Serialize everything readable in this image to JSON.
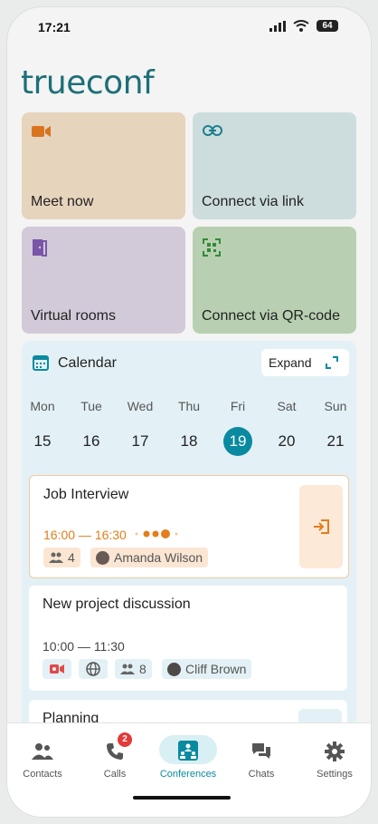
{
  "status_bar": {
    "time": "17:21",
    "battery": "64"
  },
  "app": {
    "logo": "trueconf"
  },
  "tiles": [
    {
      "label": "Meet now",
      "icon": "video-camera-icon",
      "color": "#e7d4bd"
    },
    {
      "label": "Connect via link",
      "icon": "link-icon",
      "color": "#cdddde"
    },
    {
      "label": "Virtual rooms",
      "icon": "door-icon",
      "color": "#d2cad8"
    },
    {
      "label": "Connect via QR-code",
      "icon": "qr-code-icon",
      "color": "#b8d0b1"
    }
  ],
  "calendar": {
    "title": "Calendar",
    "expand_label": "Expand",
    "days": [
      {
        "name": "Mon",
        "num": "15"
      },
      {
        "name": "Tue",
        "num": "16"
      },
      {
        "name": "Wed",
        "num": "17"
      },
      {
        "name": "Thu",
        "num": "18"
      },
      {
        "name": "Fri",
        "num": "19"
      },
      {
        "name": "Sat",
        "num": "20"
      },
      {
        "name": "Sun",
        "num": "21"
      }
    ],
    "events": [
      {
        "title": "Job Interview",
        "time": "16:00 — 16:30",
        "participants": "4",
        "person": "Amanda Wilson"
      },
      {
        "title": "New project discussion",
        "time": "10:00 — 11:30",
        "participants": "8",
        "person": "Cliff Brown"
      },
      {
        "title": "Planning"
      }
    ]
  },
  "tabs": [
    {
      "label": "Contacts",
      "icon": "contacts-icon"
    },
    {
      "label": "Calls",
      "icon": "phone-icon",
      "badge": "2"
    },
    {
      "label": "Conferences",
      "icon": "conferences-icon",
      "active": true
    },
    {
      "label": "Chats",
      "icon": "chats-icon"
    },
    {
      "label": "Settings",
      "icon": "gear-icon"
    }
  ],
  "colors": {
    "accent": "#0a8aa0",
    "orange": "#e47d1b",
    "logo": "#1d6f78"
  }
}
